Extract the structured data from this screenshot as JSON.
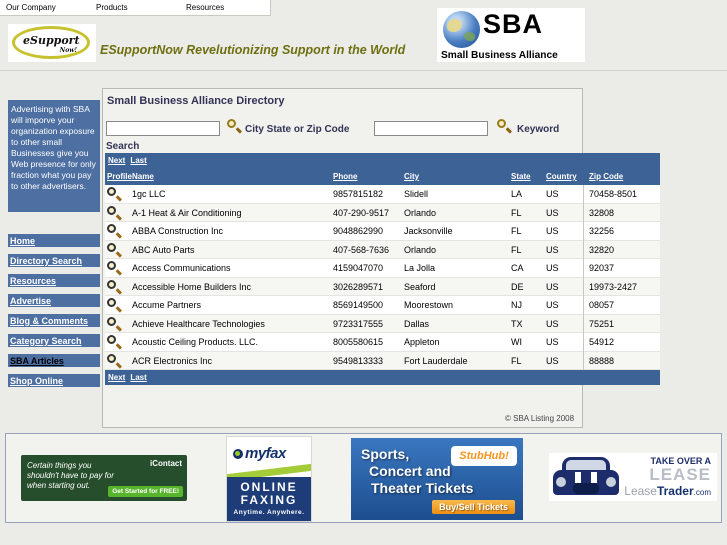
{
  "top_menu": {
    "items": [
      {
        "label": "Our Company"
      },
      {
        "label": "Products"
      },
      {
        "label": "Resources"
      }
    ]
  },
  "branding": {
    "logo_text_top": "eSupport",
    "logo_text_bottom": "Now!",
    "tagline": "ESupportNow Revelutionizing Support in the World",
    "sba": {
      "acronym": "SBA",
      "name": "Small Business Alliance",
      "icon": "globe-icon"
    }
  },
  "sidebar": {
    "ad_text": "Advertising with SBA will imporve your organization exposure to other small Businesses give you Web presence for only fraction what you pay to other advertisers.",
    "items": [
      {
        "label": "Home",
        "text_color": "white"
      },
      {
        "label": "Directory Search",
        "text_color": "white"
      },
      {
        "label": "Resources",
        "text_color": "white"
      },
      {
        "label": "Advertise",
        "text_color": "white"
      },
      {
        "label": "Blog & Comments",
        "text_color": "white"
      },
      {
        "label": "Category Search",
        "text_color": "white"
      },
      {
        "label": "SBA Articles",
        "text_color": "black"
      },
      {
        "label": "Shop Online",
        "text_color": "white"
      }
    ]
  },
  "main": {
    "title": "Small Business Alliance Directory",
    "search": {
      "city_value": "",
      "city_label": "City State or Zip Code",
      "keyword_value": "",
      "keyword_label": "Keyword",
      "search_label": "Search",
      "icon": "search-icon"
    },
    "pagination": {
      "next": "Next",
      "last": "Last"
    },
    "table": {
      "columns": [
        {
          "key": "profile",
          "label": "Profile"
        },
        {
          "key": "name",
          "label": "Name"
        },
        {
          "key": "phone",
          "label": "Phone"
        },
        {
          "key": "city",
          "label": "City"
        },
        {
          "key": "state",
          "label": "State"
        },
        {
          "key": "country",
          "label": "Country"
        },
        {
          "key": "zip",
          "label": "Zip Code"
        }
      ],
      "rows": [
        {
          "name": "1gc LLC",
          "phone": "9857815182",
          "city": "Slidell",
          "state": "LA",
          "country": "US",
          "zip": "70458-8501"
        },
        {
          "name": "A-1 Heat & Air Conditioning",
          "phone": "407-290-9517",
          "city": "Orlando",
          "state": "FL",
          "country": "US",
          "zip": "32808"
        },
        {
          "name": "ABBA Construction Inc",
          "phone": "9048862990",
          "city": "Jacksonville",
          "state": "FL",
          "country": "US",
          "zip": "32256"
        },
        {
          "name": "ABC Auto Parts",
          "phone": "407-568-7636",
          "city": "Orlando",
          "state": "FL",
          "country": "US",
          "zip": "32820"
        },
        {
          "name": "Access Communications",
          "phone": "4159047070",
          "city": "La Jolla",
          "state": "CA",
          "country": "US",
          "zip": "92037"
        },
        {
          "name": "Accessible Home Builders Inc",
          "phone": "3026289571",
          "city": "Seaford",
          "state": "DE",
          "country": "US",
          "zip": "19973-2427"
        },
        {
          "name": "Accume Partners",
          "phone": "8569149500",
          "city": "Moorestown",
          "state": "NJ",
          "country": "US",
          "zip": "08057"
        },
        {
          "name": "Achieve Healthcare Technologies",
          "phone": "9723317555",
          "city": "Dallas",
          "state": "TX",
          "country": "US",
          "zip": "75251"
        },
        {
          "name": "Acoustic Ceiling Products. LLC.",
          "phone": "8005580615",
          "city": "Appleton",
          "state": "WI",
          "country": "US",
          "zip": "54912"
        },
        {
          "name": "ACR Electronics Inc",
          "phone": "9549813333",
          "city": "Fort Lauderdale",
          "state": "FL",
          "country": "US",
          "zip": "88888"
        }
      ],
      "row_icon": "magnifier-icon"
    },
    "copyright": "© SBA Listing 2008"
  },
  "ads": {
    "icontact": {
      "line1": "Certain things you",
      "line2": "shouldn't have to pay for",
      "line3": "when starting out.",
      "brand": "iContact",
      "button": "Get Started for FREE!"
    },
    "myfax": {
      "brand": "myfax",
      "line1": "ONLINE",
      "line2": "FAXING",
      "sub": "Anytime. Anywhere."
    },
    "stubhub": {
      "line1": "Sports,",
      "line2": "Concert and",
      "line3": "Theater Tickets",
      "brand": "StubHub!",
      "button": "Buy/Sell Tickets"
    },
    "leasetrader": {
      "line1": "TAKE OVER A",
      "line2": "LEASE",
      "brand_gray": "Lease",
      "brand_bold": "Trader",
      "brand_suffix": ".com",
      "icon": "car-icon"
    }
  },
  "colors": {
    "page_background": "#ebebe8",
    "sidebar_blue": "#4d6fa1",
    "table_blue": "#3d6295",
    "tagline_olive": "#6e7010",
    "icontact_green": "#274e2c",
    "button_green": "#56b52c",
    "stubhub_blue": "#2a64ad",
    "stubhub_orange": "#f7941d",
    "myfax_navy": "#1d3c78",
    "lease_navy": "#1d2d6b"
  }
}
